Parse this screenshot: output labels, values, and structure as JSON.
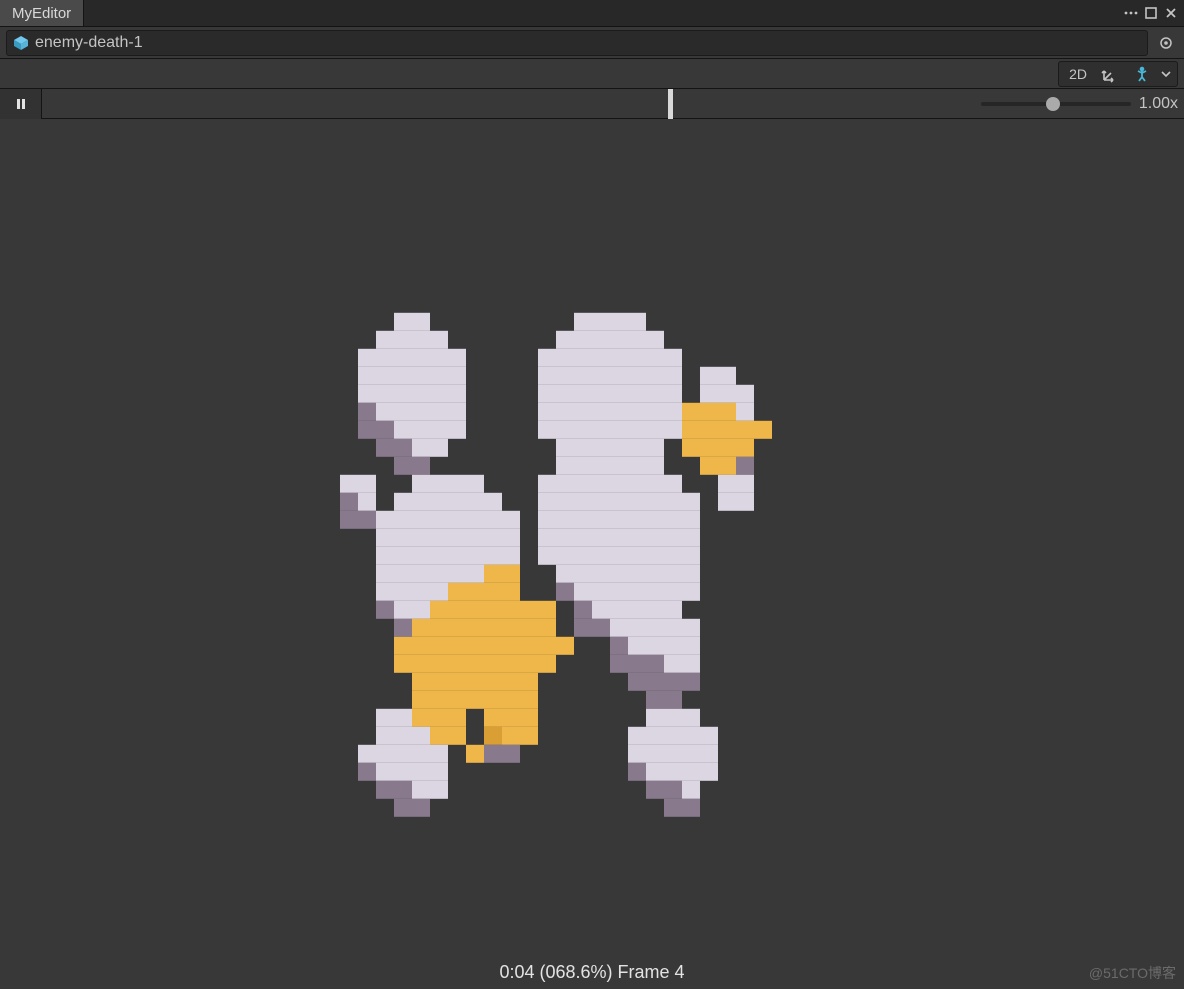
{
  "tab": {
    "title": "MyEditor"
  },
  "object_field": {
    "name": "enemy-death-1"
  },
  "toolbar": {
    "btn_2d": "2D",
    "speed_label": "1.00x",
    "playhead_ratio": 0.686,
    "slider_ratio": 0.48
  },
  "framebar": {
    "text": "0:04 (068.6%) Frame 4"
  },
  "watermark": "@51CTO博客",
  "icons": {
    "menu": "menu-icon",
    "maximize": "maximize-icon",
    "close": "close-icon",
    "cube": "cube-icon",
    "picker": "picker-icon",
    "gizmo": "gizmo-icon",
    "person": "person-icon",
    "chevron": "chevron-down-icon",
    "pause": "pause-icon"
  },
  "sprite_palette": {
    "cloud_light": "#dcd6e3",
    "cloud_shadow": "#88798d",
    "cloud_mid": "#9b8da0",
    "star": "#efb649",
    "star_shadow": "#d99f35"
  },
  "sprite_rows": [
    "..............................",
    "....ww........wwww............",
    "...wwww......wwwwww...........",
    "..wwwwww....wwwwwwww..........",
    "..wwwwww....wwwwwwww.ww.......",
    "..wwwwww....wwwwwwww.www......",
    "..swwwww....wwwwwwwwyyyw......",
    "..sswwww....wwwwwwwwyyyyy.....",
    "...ssww......wwwwww.yyyy......",
    "....ss.......wwwwww..yys......",
    ".ww..wwww...wwwwwwww..ww......",
    ".sw.wwwwww..wwwwwwwww.ww......",
    ".sswwwwwwww.wwwwwwwww.........",
    "...wwwwwwww.wwwwwwwww.........",
    "...wwwwwwww.wwwwwwwww.........",
    "...wwwwwwyy..wwwwwwww.........",
    "...wwwwyyyy..swwwwwww.........",
    "...swwyyyyyyy.swwwww..........",
    "....syyyyyyyy.sswwwww.........",
    "....yyyyyyyyyy..swwww.........",
    "....yyyyyyyyy...sssww.........",
    ".....yyyyyyy.....ssss.........",
    ".....yyyyyyy......ss..........",
    "...wwyyy.yyy......www.........",
    "...wwwyy.dyy.....wwwww........",
    "..wwwww.yss......wwwww........",
    "..swwww..........swwww........",
    "...ssww...........ssw.........",
    "....ss.............ss.........",
    ".............................."
  ]
}
